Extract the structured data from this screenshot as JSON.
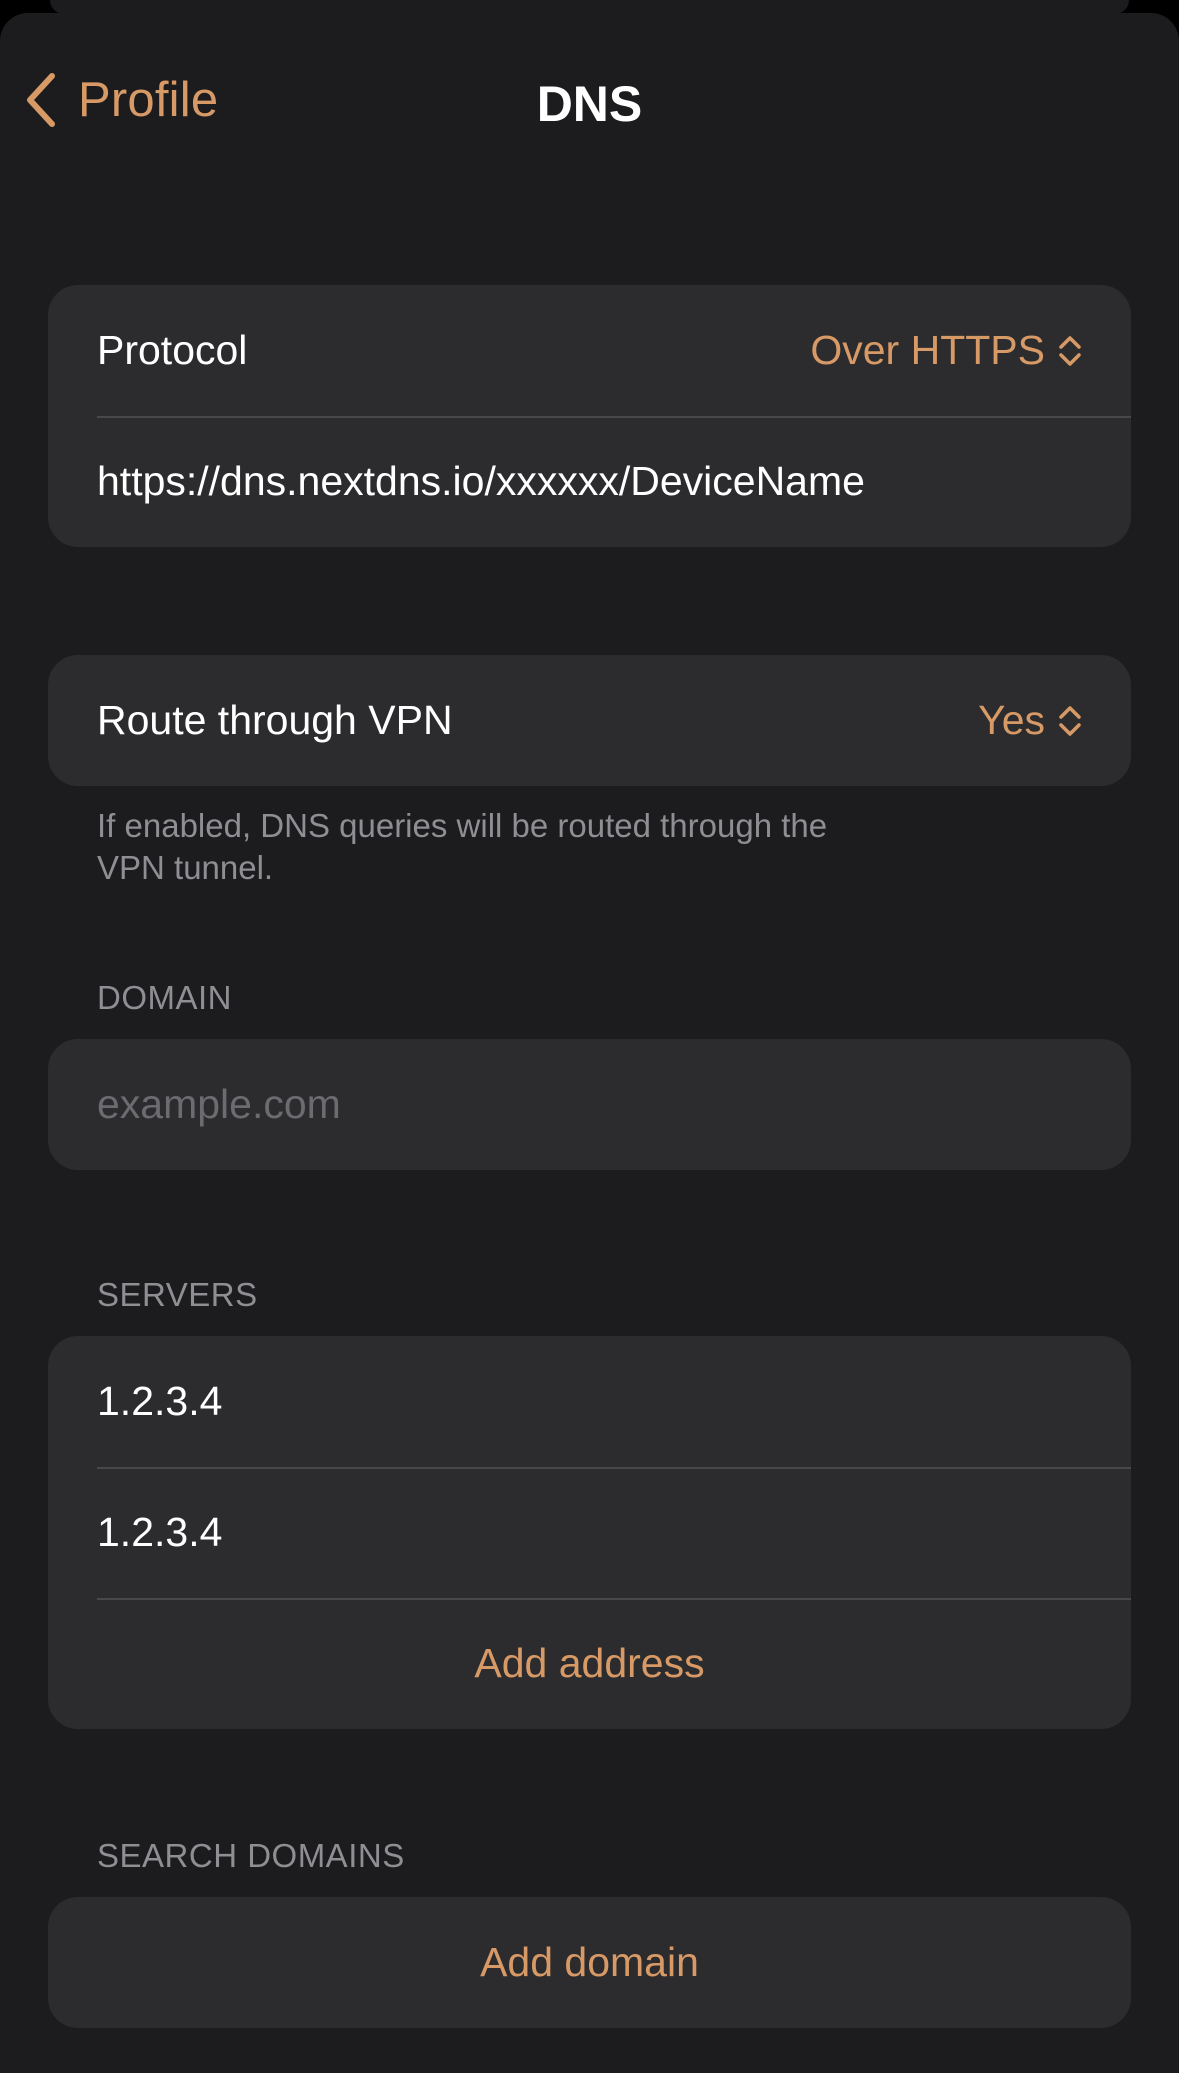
{
  "nav": {
    "back_label": "Profile",
    "title": "DNS",
    "back_icon": "chevron-left-icon"
  },
  "colors": {
    "accent": "#d79a66",
    "background": "#1c1c1e",
    "group_background": "#2c2c2e",
    "secondary_text": "#8e8e93"
  },
  "protocol_group": {
    "protocol_label": "Protocol",
    "protocol_value": "Over HTTPS",
    "protocol_icon": "chevron-up-down-icon",
    "server_url": "https://dns.nextdns.io/xxxxxx/DeviceName"
  },
  "route_group": {
    "label": "Route through VPN",
    "value": "Yes",
    "icon": "chevron-up-down-icon",
    "footer_line1": "If enabled, DNS queries will be routed through the",
    "footer_line2": "VPN tunnel."
  },
  "domain_section": {
    "header": "DOMAIN",
    "placeholder": "example.com",
    "value": ""
  },
  "servers_section": {
    "header": "SERVERS",
    "addresses": [
      "1.2.3.4",
      "1.2.3.4"
    ],
    "add_label": "Add address"
  },
  "search_domains_section": {
    "header": "SEARCH DOMAINS",
    "add_label": "Add domain"
  }
}
